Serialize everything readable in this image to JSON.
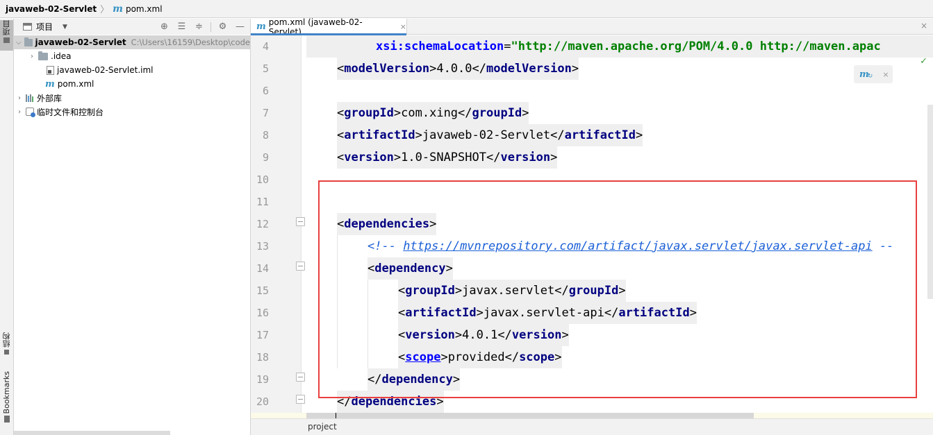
{
  "breadcrumb": {
    "project": "javaweb-02-Servlet",
    "file": "pom.xml",
    "file_icon": "m"
  },
  "left_stripe": {
    "tab_project": "项目",
    "tab_structure": "结构",
    "tab_bookmarks": "Bookmarks"
  },
  "project_panel": {
    "title": "项目",
    "tree": [
      {
        "label": "javaweb-02-Servlet",
        "path": "C:\\Users\\16159\\Desktop\\code",
        "expanded": true,
        "selected": true
      },
      {
        "label": ".idea",
        "expanded": false
      },
      {
        "label": "javaweb-02-Servlet.iml"
      },
      {
        "label": "pom.xml",
        "icon_text": "m"
      },
      {
        "label": "外部库",
        "expanded": false
      },
      {
        "label": "临时文件和控制台",
        "expanded": false
      }
    ]
  },
  "editor": {
    "tab_label": "pom.xml (javaweb-02-Servlet)",
    "tab_icon": "m",
    "close_glyph": "×",
    "maven_popup_icon": "m",
    "line_numbers": [
      "4",
      "5",
      "6",
      "7",
      "8",
      "9",
      "10",
      "11",
      "12",
      "13",
      "14",
      "15",
      "16",
      "17",
      "18",
      "19",
      "20"
    ],
    "lines": {
      "l4_attr": "xsi:schemaLocation",
      "l4_val": "\"http://maven.apache.org/POM/4.0.0 http://maven.apac",
      "model_tag": "modelVersion",
      "model_val": "4.0.0",
      "group_tag": "groupId",
      "group_val": "com.xing",
      "artifact_tag": "artifactId",
      "artifact_val": "javaweb-02-Servlet",
      "version_tag": "version",
      "version_val": "1.0-SNAPSHOT",
      "deps_tag": "dependencies",
      "comment_open": "<!-- ",
      "comment_url": "https://mvnrepository.com/artifact/javax.servlet/javax.servlet-api",
      "comment_close": " --",
      "dep_tag": "dependency",
      "dep_group_val": "javax.servlet",
      "dep_artifact_val": "javax.servlet-api",
      "dep_version_val": "4.0.1",
      "scope_tag": "scope",
      "scope_val": "provided"
    }
  },
  "status_bar": {
    "text": "project"
  },
  "colors": {
    "highlight_box": "#e8403f",
    "tag": "#000080",
    "value": "#008000",
    "comment": "#1a5fd6"
  }
}
